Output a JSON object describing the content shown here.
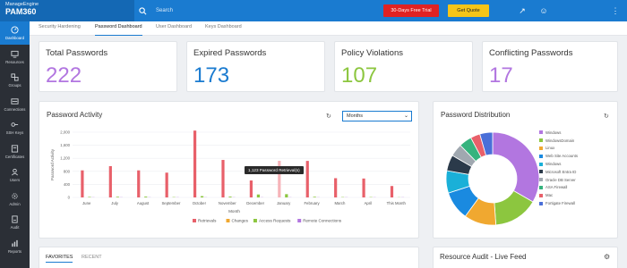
{
  "header": {
    "company": "ManageEngine",
    "product": "PAM360",
    "search_placeholder": "Search",
    "trial_label": "30-Days Free Trial",
    "quote_label": "Get Quote"
  },
  "nav": [
    {
      "label": "Dashboard",
      "icon": "dashboard-icon"
    },
    {
      "label": "Resources",
      "icon": "monitor-icon"
    },
    {
      "label": "Groups",
      "icon": "groups-icon"
    },
    {
      "label": "Connections",
      "icon": "connections-icon"
    },
    {
      "label": "SSH Keys",
      "icon": "key-icon"
    },
    {
      "label": "Certificates",
      "icon": "certificate-icon"
    },
    {
      "label": "Users",
      "icon": "users-icon"
    },
    {
      "label": "Admin",
      "icon": "admin-gear-icon"
    },
    {
      "label": "Audit",
      "icon": "audit-icon"
    },
    {
      "label": "Reports",
      "icon": "reports-icon"
    }
  ],
  "tabs": [
    "Security Hardening",
    "Password Dashboard",
    "User Dashboard",
    "Keys Dashboard"
  ],
  "kpis": [
    {
      "title": "Total Passwords",
      "value": "222",
      "color": "#b276e0"
    },
    {
      "title": "Expired Passwords",
      "value": "173",
      "color": "#1a7bd0"
    },
    {
      "title": "Policy Violations",
      "value": "107",
      "color": "#8cc63f"
    },
    {
      "title": "Conflicting Passwords",
      "value": "17",
      "color": "#b276e0"
    }
  ],
  "activity": {
    "title": "Password Activity",
    "select_value": "Months",
    "tooltip": "1,123 Password Retrieval(s)"
  },
  "chart_data": {
    "type": "bar",
    "xlabel": "Month",
    "ylabel": "Password Activity",
    "ylim": [
      0,
      2000
    ],
    "yticks": [
      "0",
      "400",
      "800",
      "1,200",
      "1,600",
      "2,000"
    ],
    "categories": [
      "June",
      "July",
      "August",
      "September",
      "October",
      "November",
      "December",
      "January",
      "February",
      "March",
      "April",
      "This Month"
    ],
    "series": [
      {
        "name": "Retrievals",
        "color": "#e8606a",
        "values": [
          830,
          960,
          830,
          760,
          2050,
          1150,
          520,
          1123,
          1120,
          590,
          580,
          350
        ]
      },
      {
        "name": "Changes",
        "color": "#f0a830",
        "values": [
          0,
          0,
          0,
          0,
          0,
          0,
          0,
          0,
          0,
          0,
          0,
          0
        ]
      },
      {
        "name": "Access Requests",
        "color": "#8cc63f",
        "values": [
          15,
          20,
          25,
          10,
          40,
          25,
          90,
          100,
          20,
          10,
          10,
          5
        ]
      },
      {
        "name": "Remote Connections",
        "color": "#b276e0",
        "values": [
          5,
          5,
          5,
          5,
          5,
          5,
          5,
          5,
          5,
          5,
          5,
          5
        ]
      }
    ]
  },
  "distribution": {
    "title": "Password Distribution",
    "legend": [
      {
        "label": "Windows",
        "color": "#b276e0",
        "value": 30
      },
      {
        "label": "WindowsDomain",
        "color": "#8cc63f",
        "value": 14
      },
      {
        "label": "Linux",
        "color": "#f0a830",
        "value": 10
      },
      {
        "label": "Web Site Accounts",
        "color": "#1a8ae0",
        "value": 9
      },
      {
        "label": "Windows",
        "color": "#1ab0d8",
        "value": 7
      },
      {
        "label": "Microsoft Entra ID",
        "color": "#2b3a4a",
        "value": 5
      },
      {
        "label": "Oracle DB Server",
        "color": "#a0a8b0",
        "value": 4
      },
      {
        "label": "ASA Firewall",
        "color": "#36b37e",
        "value": 4
      },
      {
        "label": "Mac",
        "color": "#e8606a",
        "value": 3
      },
      {
        "label": "Fortigate Firewall",
        "color": "#4a6fd8",
        "value": 4
      }
    ]
  },
  "bottom": {
    "favorites": "FAVORITES",
    "recent": "RECENT",
    "feed_title": "Resource Audit - Live Feed"
  }
}
